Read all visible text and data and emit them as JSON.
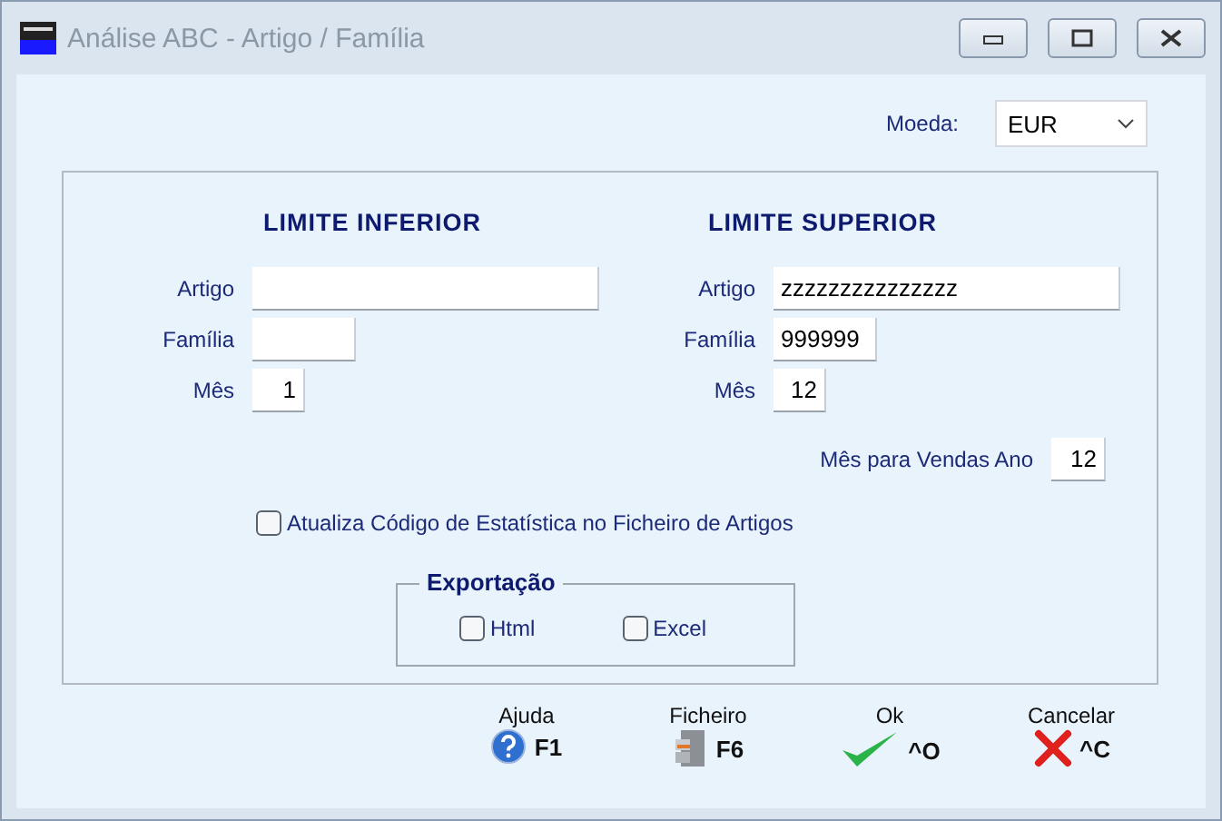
{
  "window": {
    "title": "Análise ABC - Artigo / Família"
  },
  "currency": {
    "label": "Moeda:",
    "value": "EUR"
  },
  "columns": [
    {
      "heading": "LIMITE INFERIOR",
      "fields": [
        {
          "label": "Artigo"
        },
        {
          "label": "Família"
        },
        {
          "label": "Mês",
          "value": "1"
        }
      ]
    },
    {
      "heading": "LIMITE SUPERIOR",
      "fields": [
        {
          "label": "Artigo",
          "value": "zzzzzzzzzzzzzzz"
        },
        {
          "label": "Família",
          "value": "999999"
        },
        {
          "label": "Mês",
          "value": "12"
        }
      ]
    }
  ],
  "sales_month": {
    "label": "Mês para Vendas Ano",
    "value": "12"
  },
  "update_stats": {
    "label": "Atualiza Código de Estatística no Ficheiro de Artigos",
    "checked": false
  },
  "export": {
    "title": "Exportação",
    "options": [
      {
        "label": "Html",
        "checked": false
      },
      {
        "label": "Excel",
        "checked": false
      }
    ]
  },
  "actions": [
    {
      "kind": "help",
      "label": "Ajuda",
      "shortcut": "F1"
    },
    {
      "kind": "file",
      "label": "Ficheiro",
      "shortcut": "F6"
    },
    {
      "kind": "ok",
      "label": "Ok",
      "shortcut": "^O"
    },
    {
      "kind": "cancel",
      "label": "Cancelar",
      "shortcut": "^C"
    }
  ]
}
